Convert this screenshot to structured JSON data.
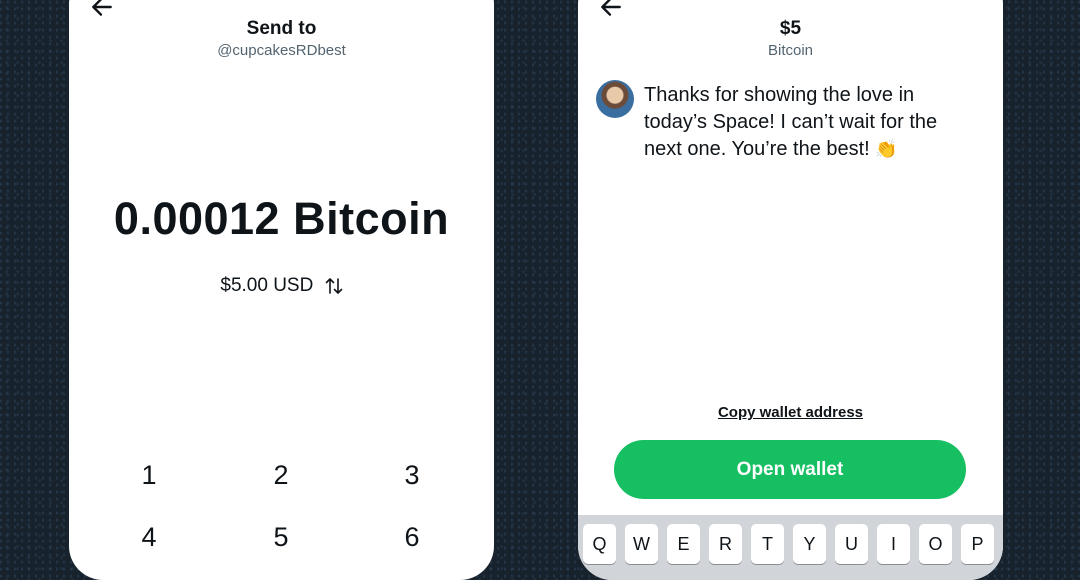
{
  "send_screen": {
    "title": "Send to",
    "recipient": "@cupcakesRDbest",
    "amount_crypto": "0.00012 Bitcoin",
    "amount_fiat": "$5.00 USD",
    "keypad": [
      "1",
      "2",
      "3",
      "4",
      "5",
      "6"
    ]
  },
  "confirm_screen": {
    "title": "$5",
    "subtitle": "Bitcoin",
    "message": "Thanks for showing the love in today’s Space! I can’t wait for the next one. You’re the best!",
    "message_emoji": "👏",
    "copy_link": "Copy wallet address",
    "open_button": "Open wallet",
    "keyboard_row": [
      "Q",
      "W",
      "E",
      "R",
      "T",
      "Y",
      "U",
      "I",
      "O",
      "P"
    ]
  },
  "colors": {
    "accent": "#17bf63",
    "text": "#0f1419",
    "secondary": "#536471",
    "background": "#17222d"
  },
  "icons": [
    "back-arrow-icon",
    "swap-icon"
  ]
}
